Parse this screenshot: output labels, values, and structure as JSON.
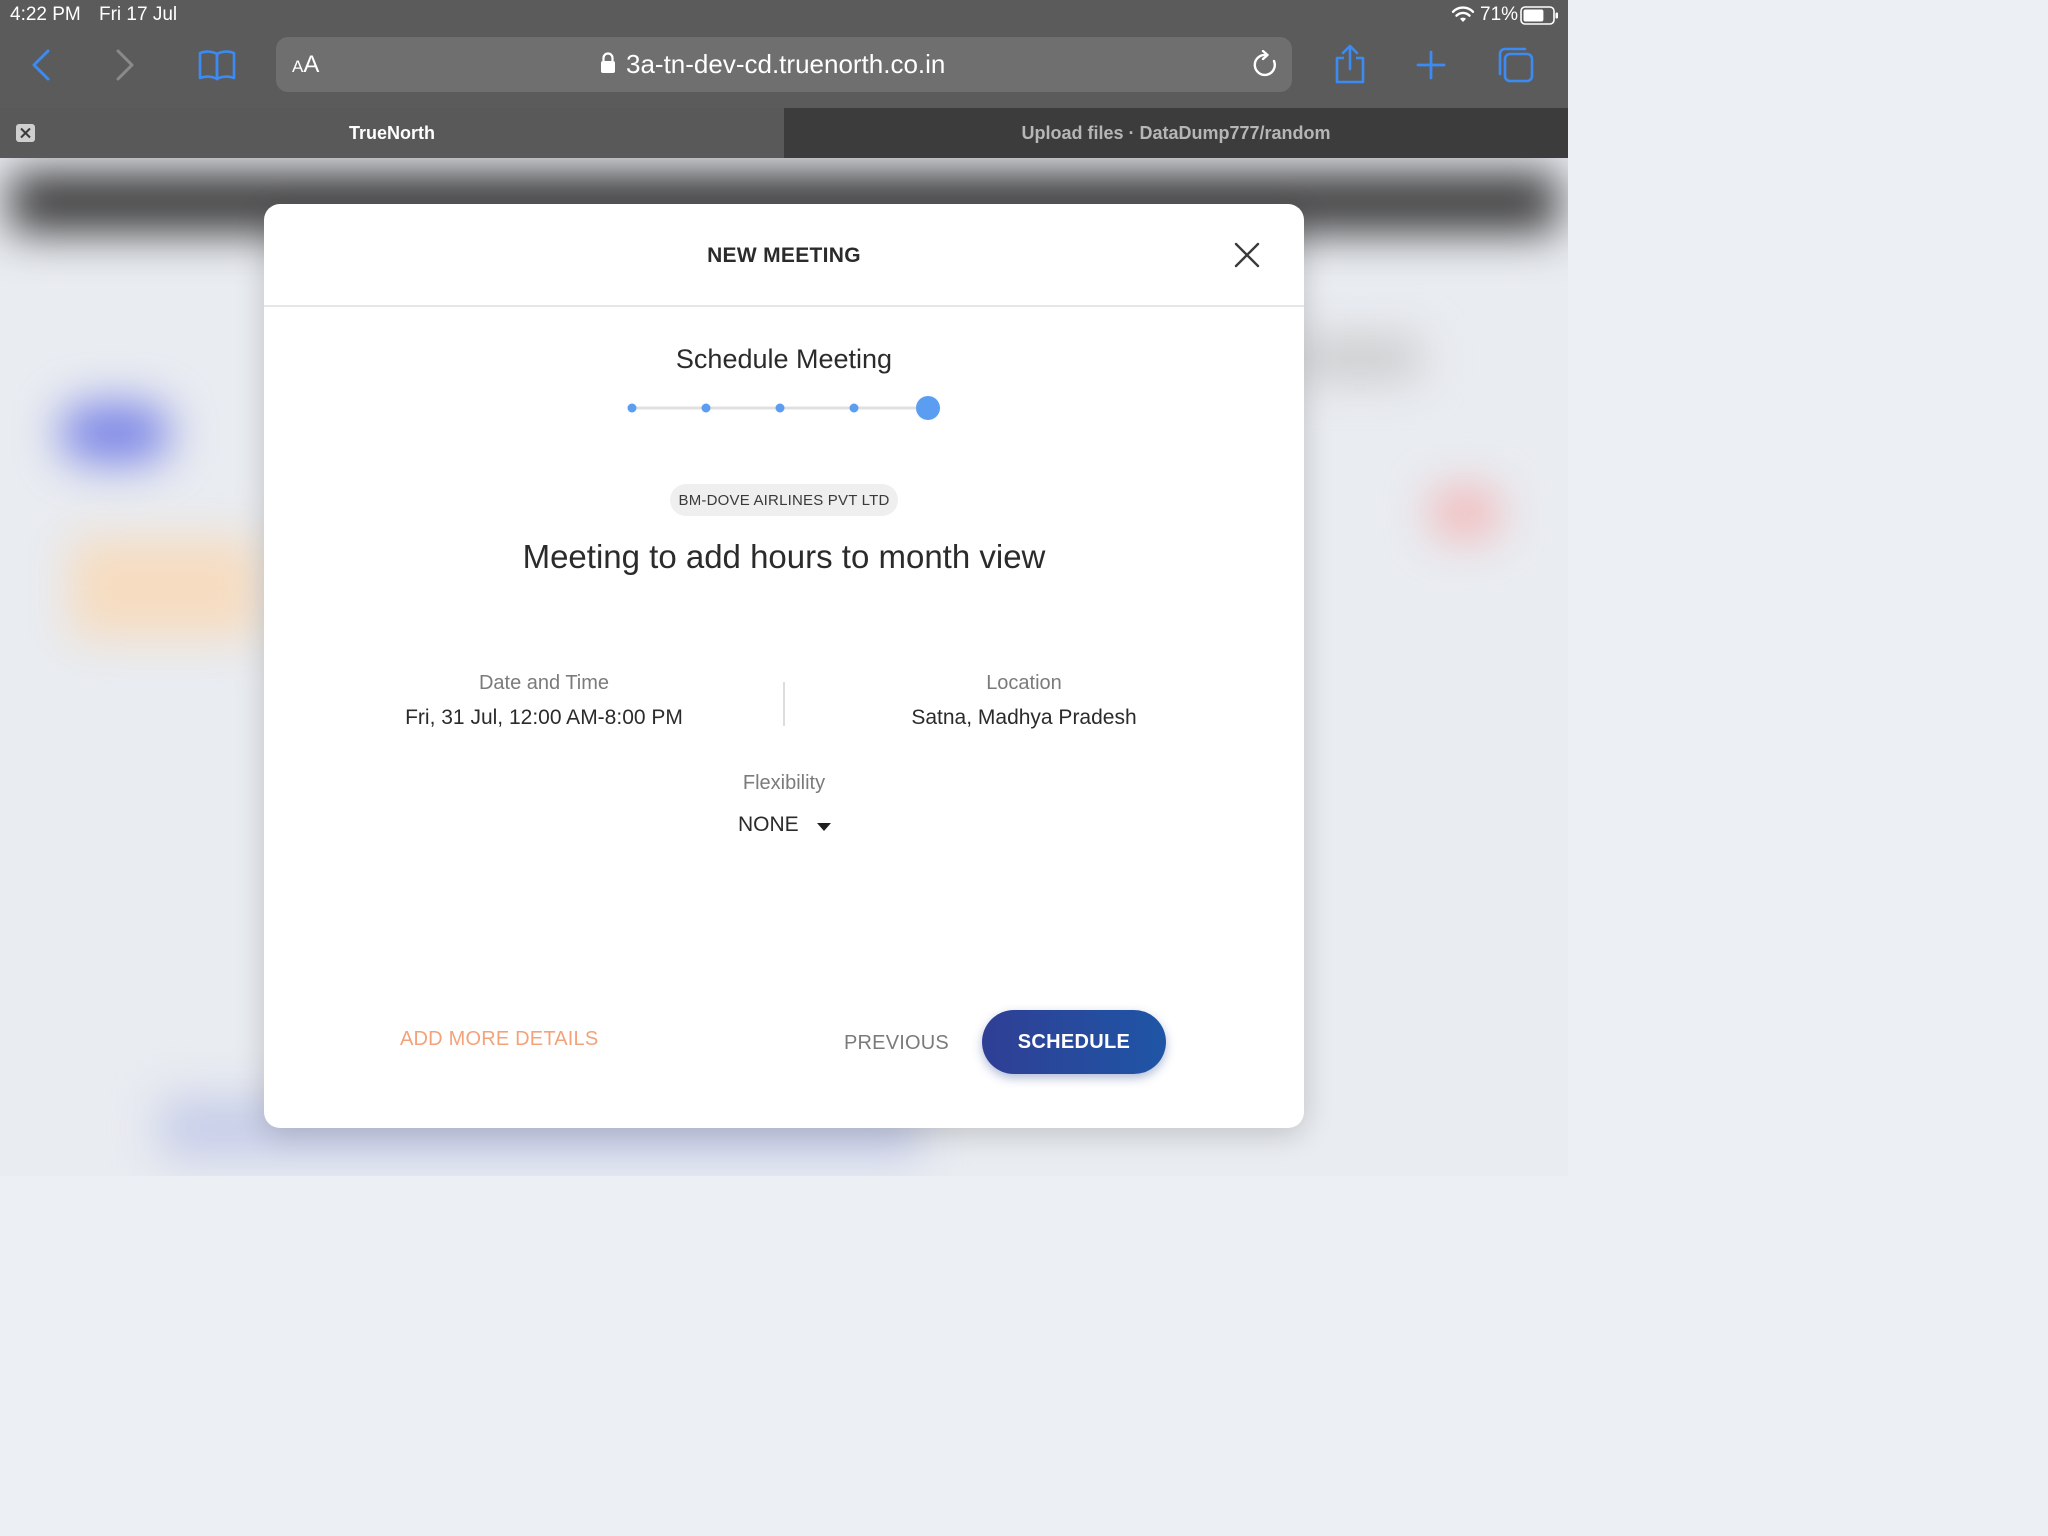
{
  "status_bar": {
    "time": "4:22 PM",
    "date": "Fri 17 Jul",
    "battery_percent": "71%",
    "battery_level": 0.71
  },
  "browser": {
    "text_size_button_small": "A",
    "text_size_button_large": "A",
    "url": "3a-tn-dev-cd.truenorth.co.in",
    "icons": {
      "back": "chevron-left-icon",
      "forward": "chevron-right-icon",
      "bookmarks": "book-icon",
      "lock": "lock-icon",
      "reload": "reload-icon",
      "share": "share-icon",
      "new_tab": "plus-icon",
      "tabs_overview": "tabs-icon"
    },
    "accent_color": "#3c8bf2",
    "tabs": [
      {
        "title": "TrueNorth",
        "active": true
      },
      {
        "title": "Upload files · DataDump777/random",
        "active": false
      }
    ]
  },
  "modal": {
    "title": "NEW MEETING",
    "step_title": "Schedule Meeting",
    "stepper": {
      "total_steps": 5,
      "current_step": 5,
      "color": "#5b9df0"
    },
    "company": "BM-DOVE AIRLINES PVT LTD",
    "meeting_title": "Meeting to add hours to month view",
    "date_time": {
      "label": "Date and Time",
      "value": "Fri, 31 Jul, 12:00 AM-8:00 PM"
    },
    "location": {
      "label": "Location",
      "value": "Satna, Madhya Pradesh"
    },
    "flexibility": {
      "label": "Flexibility",
      "value": "NONE"
    },
    "actions": {
      "add_more_details": "ADD MORE DETAILS",
      "previous": "PREVIOUS",
      "schedule": "SCHEDULE"
    },
    "colors": {
      "add_more_details": "#f4a27a",
      "schedule_button_start": "#2f3f94",
      "schedule_button_end": "#1f55a6"
    }
  }
}
